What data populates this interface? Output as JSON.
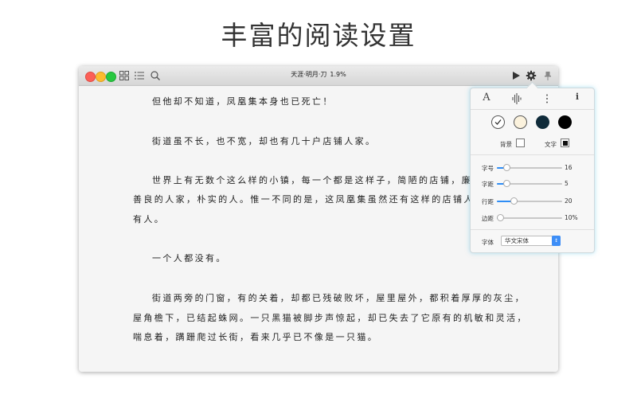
{
  "headline": "丰富的阅读设置",
  "window": {
    "title": "天涯·明月·刀",
    "progress": "1.9%"
  },
  "toolbar": {
    "icons": [
      "grid-icon",
      "list-icon",
      "search-icon",
      "play-icon",
      "gear-icon",
      "pin-icon"
    ]
  },
  "text": {
    "p1": "但他却不知道，凤凰集本身也已死亡！",
    "p2": "街道虽不长，也不宽，却也有几十户店铺人家。",
    "p3a": "世界上有无数个这么样的小镇，每一个都是这样子，简陋的店铺，廉价的",
    "p3b": "善良的人家，朴实的人。惟一不同的是，这凤凰集虽然还有这样的店铺人家，",
    "p3c": "有人。",
    "p4": "一个人都没有。",
    "p5a": "街道两旁的门窗，有的关着，却都已残破败坏，屋里屋外，都积着厚厚的灰尘，",
    "p5b": "屋角檐下，已结起蛛网。一只黑猫被脚步声惊起，却已失去了它原有的机敏和灵活，",
    "p5c": "喘息着，蹒跚爬过长街，看来几乎已不像是一只猫。"
  },
  "settings": {
    "tabs": {
      "font": "A",
      "audio_icon": "waveform-icon",
      "more_icon": "more-icon",
      "info": "i"
    },
    "themes": [
      {
        "name": "white",
        "color": "#ffffff",
        "selected": true
      },
      {
        "name": "cream",
        "color": "#fbf2dd",
        "selected": false
      },
      {
        "name": "dark-teal",
        "color": "#0f2b3a",
        "selected": false
      },
      {
        "name": "black",
        "color": "#000000",
        "selected": false
      }
    ],
    "bg_label": "背景",
    "text_label": "文字",
    "sliders": [
      {
        "label": "字号",
        "value": "16",
        "level": 0.15
      },
      {
        "label": "字距",
        "value": "5",
        "level": 0.15
      },
      {
        "label": "行距",
        "value": "20",
        "level": 0.25
      },
      {
        "label": "边距",
        "value": "10%",
        "level": 0.05
      }
    ],
    "font_label": "字体",
    "font_value": "华文宋体",
    "accent": "#2f8df5"
  }
}
